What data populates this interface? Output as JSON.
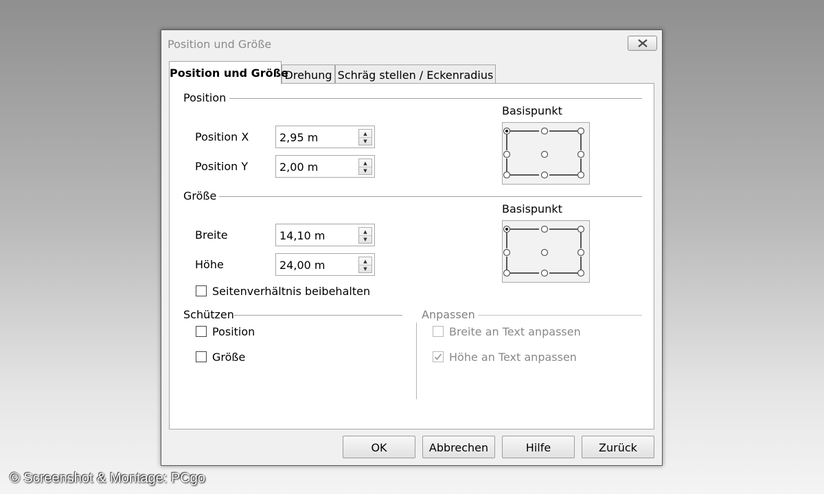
{
  "window": {
    "title": "Position und Größe"
  },
  "tabs": [
    {
      "label": "Position und Größe",
      "active": true
    },
    {
      "label": "Drehung",
      "active": false
    },
    {
      "label": "Schräg stellen / Eckenradius",
      "active": false
    }
  ],
  "position_section": {
    "heading": "Position",
    "x_label": "Position X",
    "x_value": "2,95 m",
    "y_label": "Position Y",
    "y_value": "2,00 m",
    "basepoint_label": "Basispunkt"
  },
  "size_section": {
    "heading": "Größe",
    "width_label": "Breite",
    "width_value": "14,10 m",
    "height_label": "Höhe",
    "height_value": "24,00 m",
    "basepoint_label": "Basispunkt",
    "keep_ratio_label": "Seitenverhältnis beibehalten",
    "keep_ratio_checked": false
  },
  "protect_section": {
    "heading": "Schützen",
    "position_label": "Position",
    "position_checked": false,
    "size_label": "Größe",
    "size_checked": false
  },
  "adapt_section": {
    "heading": "Anpassen",
    "fit_width_label": "Breite an Text anpassen",
    "fit_width_checked": false,
    "fit_height_label": "Höhe an Text anpassen",
    "fit_height_checked": true
  },
  "buttons": {
    "ok": "OK",
    "cancel": "Abbrechen",
    "help": "Hilfe",
    "reset": "Zurück"
  },
  "credit": "© Screenshot & Montage: PCgo",
  "icons": {
    "close": "close-icon",
    "spin": "spin-arrows-icon",
    "check": "checkmark-icon"
  },
  "colors": {
    "disabled_text": "#808080",
    "panel_bg": "#ffffff",
    "dialog_bg": "#f0f0f0"
  }
}
